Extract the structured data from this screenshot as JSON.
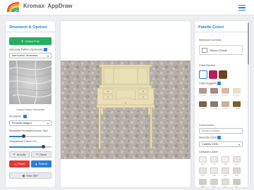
{
  "app": {
    "title": "Kromax· AppDraw"
  },
  "left": {
    "title": "Strumenti & Opzioni",
    "upload_label": "Carica Foto",
    "pattern_label": "Selezione Pattern (Opzionale)",
    "pattern_value": "Marmorino Veneziano",
    "pattern_caption": "Carica Pattern Personale",
    "tool_label": "Strumento",
    "tool_value": "Pennello Magico",
    "brush_label": "Sensitività Pennello/Gomma: 20px",
    "brush_value": 0.34,
    "opacity_label": "Trasparenza Colore: 0.8",
    "opacity_value": 0.8,
    "undo_label": "Annulla",
    "redo_label": "Ripeti",
    "reset_label": "Reset",
    "save_label": "Scarica",
    "view_label": "Vista 360°"
  },
  "right": {
    "title": "Palette Colori",
    "current_label": "Selezione Corrente:",
    "current_value": "Bianco Default",
    "recent_label": "Colori Recenti",
    "recent": [
      "#ffffff",
      "#b51f5b",
      "#6b4423"
    ],
    "suggested_label": "Colori Suggeriti",
    "suggested": [
      {
        "c": "#b39a90",
        "n": "CC 12-16"
      },
      {
        "c": "#a58a87",
        "n": "CC 12-18"
      },
      {
        "c": "#d8b9a6",
        "n": "CC 12-15"
      },
      {
        "c": "#e6e1c9",
        "n": "CC 10-14"
      },
      {
        "c": "#7a6154",
        "n": "CC 14-16"
      },
      {
        "c": "#8a7b6b",
        "n": "CC 14-18"
      },
      {
        "c": "#c7b29b",
        "n": "CC 13-21"
      },
      {
        "c": "#7a5f2a",
        "n": "CC 16-08"
      }
    ],
    "search_label": "Cerca Colore",
    "search_placeholder": "Nome o codice",
    "palette_label": "Mazzetta Colori",
    "palette_value": "Cartella 120K",
    "samples_label": "Campioni Colore",
    "samples": [
      {
        "c": "#f1efea",
        "n": "0001"
      },
      {
        "c": "#eceae3",
        "n": "0002"
      },
      {
        "c": "#f2f1ea",
        "n": "0003"
      },
      {
        "c": "#e9e7e0",
        "n": "0004"
      },
      {
        "c": "#e7e4dc",
        "n": "0005"
      },
      {
        "c": "#e9e8e2",
        "n": "0006"
      },
      {
        "c": "#e4e2db",
        "n": "0007"
      },
      {
        "c": "#d9d6cf",
        "n": "0008"
      },
      {
        "c": "#cfcdc6",
        "n": "0009"
      },
      {
        "c": "#d5d3cc",
        "n": "0010"
      },
      {
        "c": "#dfddd6",
        "n": "0011"
      },
      {
        "c": "#cac8c1",
        "n": "0012"
      }
    ]
  }
}
